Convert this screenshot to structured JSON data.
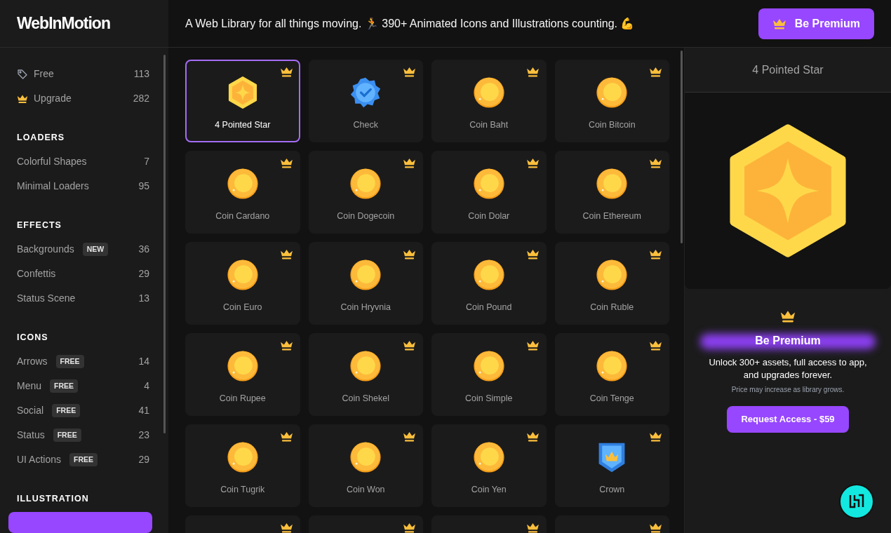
{
  "logo": "WebInMotion",
  "header": {
    "tagline": "A Web Library for all things moving. 🏃 390+ Animated Icons and Illustrations counting. 💪",
    "premium_button": "Be Premium"
  },
  "sidebar": {
    "filters": [
      {
        "kind": "tag",
        "label": "Free",
        "count": "113"
      },
      {
        "kind": "crown",
        "label": "Upgrade",
        "count": "282"
      }
    ],
    "sections": [
      {
        "title": "LOADERS",
        "items": [
          {
            "label": "Colorful Shapes",
            "count": "7"
          },
          {
            "label": "Minimal Loaders",
            "count": "95"
          }
        ]
      },
      {
        "title": "EFFECTS",
        "items": [
          {
            "label": "Backgrounds",
            "badge": "NEW",
            "count": "36"
          },
          {
            "label": "Confettis",
            "count": "29"
          },
          {
            "label": "Status Scene",
            "count": "13"
          }
        ]
      },
      {
        "title": "ICONS",
        "items": [
          {
            "label": "Arrows",
            "badge": "FREE",
            "count": "14"
          },
          {
            "label": "Menu",
            "badge": "FREE",
            "count": "4"
          },
          {
            "label": "Social",
            "badge": "FREE",
            "count": "41"
          },
          {
            "label": "Status",
            "badge": "FREE",
            "count": "23"
          },
          {
            "label": "UI Actions",
            "badge": "FREE",
            "count": "29"
          }
        ]
      },
      {
        "title": "ILLUSTRATION",
        "items": [
          {
            "selected": true
          }
        ]
      }
    ]
  },
  "grid": [
    {
      "kind": "star",
      "label": "4 Pointed Star",
      "selected": true
    },
    {
      "kind": "check",
      "label": "Check",
      "selected": false
    },
    {
      "kind": "coin",
      "label": "Coin Baht",
      "selected": false
    },
    {
      "kind": "coin",
      "label": "Coin Bitcoin",
      "selected": false
    },
    {
      "kind": "coin",
      "label": "Coin Cardano",
      "selected": false
    },
    {
      "kind": "coin",
      "label": "Coin Dogecoin",
      "selected": false
    },
    {
      "kind": "coin",
      "label": "Coin Dolar",
      "selected": false
    },
    {
      "kind": "coin",
      "label": "Coin Ethereum",
      "selected": false
    },
    {
      "kind": "coin",
      "label": "Coin Euro",
      "selected": false
    },
    {
      "kind": "coin",
      "label": "Coin Hryvnia",
      "selected": false
    },
    {
      "kind": "coin",
      "label": "Coin Pound",
      "selected": false
    },
    {
      "kind": "coin",
      "label": "Coin Ruble",
      "selected": false
    },
    {
      "kind": "coin",
      "label": "Coin Rupee",
      "selected": false
    },
    {
      "kind": "coin",
      "label": "Coin Shekel",
      "selected": false
    },
    {
      "kind": "coin",
      "label": "Coin Simple",
      "selected": false
    },
    {
      "kind": "coin",
      "label": "Coin Tenge",
      "selected": false
    },
    {
      "kind": "coin",
      "label": "Coin Tugrik",
      "selected": false
    },
    {
      "kind": "coin",
      "label": "Coin Won",
      "selected": false
    },
    {
      "kind": "coin",
      "label": "Coin Yen",
      "selected": false
    },
    {
      "kind": "shield",
      "label": "Crown",
      "selected": false
    },
    {
      "kind": "cut",
      "selected": false
    },
    {
      "kind": "cut",
      "selected": false
    },
    {
      "kind": "cut",
      "selected": false
    },
    {
      "kind": "cut",
      "selected": false
    }
  ],
  "preview": {
    "title": "4 Pointed Star",
    "kind": "star"
  },
  "premium": {
    "title": "Be Premium",
    "text": "Unlock 300+ assets, full access to app, and upgrades forever.",
    "note": "Price may increase as library grows.",
    "button": "Request Access - $59"
  }
}
